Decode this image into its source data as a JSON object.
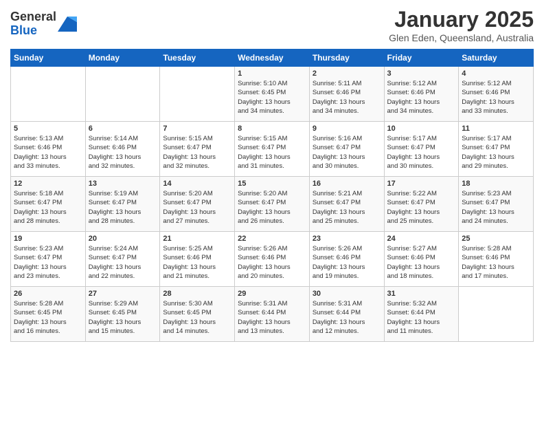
{
  "header": {
    "logo_general": "General",
    "logo_blue": "Blue",
    "month": "January 2025",
    "location": "Glen Eden, Queensland, Australia"
  },
  "days_of_week": [
    "Sunday",
    "Monday",
    "Tuesday",
    "Wednesday",
    "Thursday",
    "Friday",
    "Saturday"
  ],
  "weeks": [
    [
      {
        "day": "",
        "info": ""
      },
      {
        "day": "",
        "info": ""
      },
      {
        "day": "",
        "info": ""
      },
      {
        "day": "1",
        "info": "Sunrise: 5:10 AM\nSunset: 6:45 PM\nDaylight: 13 hours\nand 34 minutes."
      },
      {
        "day": "2",
        "info": "Sunrise: 5:11 AM\nSunset: 6:46 PM\nDaylight: 13 hours\nand 34 minutes."
      },
      {
        "day": "3",
        "info": "Sunrise: 5:12 AM\nSunset: 6:46 PM\nDaylight: 13 hours\nand 34 minutes."
      },
      {
        "day": "4",
        "info": "Sunrise: 5:12 AM\nSunset: 6:46 PM\nDaylight: 13 hours\nand 33 minutes."
      }
    ],
    [
      {
        "day": "5",
        "info": "Sunrise: 5:13 AM\nSunset: 6:46 PM\nDaylight: 13 hours\nand 33 minutes."
      },
      {
        "day": "6",
        "info": "Sunrise: 5:14 AM\nSunset: 6:46 PM\nDaylight: 13 hours\nand 32 minutes."
      },
      {
        "day": "7",
        "info": "Sunrise: 5:15 AM\nSunset: 6:47 PM\nDaylight: 13 hours\nand 32 minutes."
      },
      {
        "day": "8",
        "info": "Sunrise: 5:15 AM\nSunset: 6:47 PM\nDaylight: 13 hours\nand 31 minutes."
      },
      {
        "day": "9",
        "info": "Sunrise: 5:16 AM\nSunset: 6:47 PM\nDaylight: 13 hours\nand 30 minutes."
      },
      {
        "day": "10",
        "info": "Sunrise: 5:17 AM\nSunset: 6:47 PM\nDaylight: 13 hours\nand 30 minutes."
      },
      {
        "day": "11",
        "info": "Sunrise: 5:17 AM\nSunset: 6:47 PM\nDaylight: 13 hours\nand 29 minutes."
      }
    ],
    [
      {
        "day": "12",
        "info": "Sunrise: 5:18 AM\nSunset: 6:47 PM\nDaylight: 13 hours\nand 28 minutes."
      },
      {
        "day": "13",
        "info": "Sunrise: 5:19 AM\nSunset: 6:47 PM\nDaylight: 13 hours\nand 28 minutes."
      },
      {
        "day": "14",
        "info": "Sunrise: 5:20 AM\nSunset: 6:47 PM\nDaylight: 13 hours\nand 27 minutes."
      },
      {
        "day": "15",
        "info": "Sunrise: 5:20 AM\nSunset: 6:47 PM\nDaylight: 13 hours\nand 26 minutes."
      },
      {
        "day": "16",
        "info": "Sunrise: 5:21 AM\nSunset: 6:47 PM\nDaylight: 13 hours\nand 25 minutes."
      },
      {
        "day": "17",
        "info": "Sunrise: 5:22 AM\nSunset: 6:47 PM\nDaylight: 13 hours\nand 25 minutes."
      },
      {
        "day": "18",
        "info": "Sunrise: 5:23 AM\nSunset: 6:47 PM\nDaylight: 13 hours\nand 24 minutes."
      }
    ],
    [
      {
        "day": "19",
        "info": "Sunrise: 5:23 AM\nSunset: 6:47 PM\nDaylight: 13 hours\nand 23 minutes."
      },
      {
        "day": "20",
        "info": "Sunrise: 5:24 AM\nSunset: 6:47 PM\nDaylight: 13 hours\nand 22 minutes."
      },
      {
        "day": "21",
        "info": "Sunrise: 5:25 AM\nSunset: 6:46 PM\nDaylight: 13 hours\nand 21 minutes."
      },
      {
        "day": "22",
        "info": "Sunrise: 5:26 AM\nSunset: 6:46 PM\nDaylight: 13 hours\nand 20 minutes."
      },
      {
        "day": "23",
        "info": "Sunrise: 5:26 AM\nSunset: 6:46 PM\nDaylight: 13 hours\nand 19 minutes."
      },
      {
        "day": "24",
        "info": "Sunrise: 5:27 AM\nSunset: 6:46 PM\nDaylight: 13 hours\nand 18 minutes."
      },
      {
        "day": "25",
        "info": "Sunrise: 5:28 AM\nSunset: 6:46 PM\nDaylight: 13 hours\nand 17 minutes."
      }
    ],
    [
      {
        "day": "26",
        "info": "Sunrise: 5:28 AM\nSunset: 6:45 PM\nDaylight: 13 hours\nand 16 minutes."
      },
      {
        "day": "27",
        "info": "Sunrise: 5:29 AM\nSunset: 6:45 PM\nDaylight: 13 hours\nand 15 minutes."
      },
      {
        "day": "28",
        "info": "Sunrise: 5:30 AM\nSunset: 6:45 PM\nDaylight: 13 hours\nand 14 minutes."
      },
      {
        "day": "29",
        "info": "Sunrise: 5:31 AM\nSunset: 6:44 PM\nDaylight: 13 hours\nand 13 minutes."
      },
      {
        "day": "30",
        "info": "Sunrise: 5:31 AM\nSunset: 6:44 PM\nDaylight: 13 hours\nand 12 minutes."
      },
      {
        "day": "31",
        "info": "Sunrise: 5:32 AM\nSunset: 6:44 PM\nDaylight: 13 hours\nand 11 minutes."
      },
      {
        "day": "",
        "info": ""
      }
    ]
  ]
}
